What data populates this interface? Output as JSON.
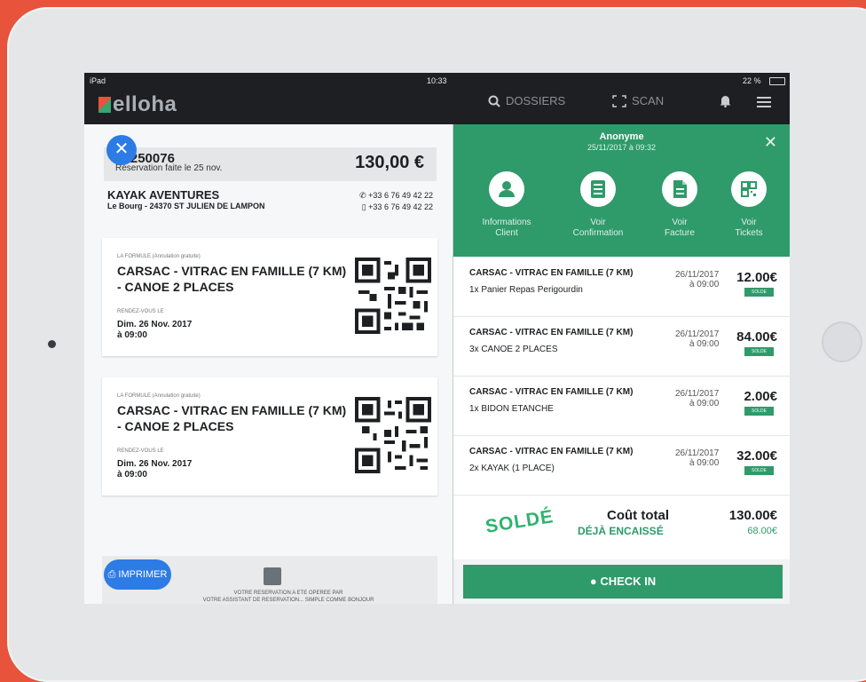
{
  "status": {
    "device": "iPad",
    "time": "10:33",
    "battery": "22 %"
  },
  "app": {
    "logo": "elloha",
    "nav_dossiers": "DOSSIERS",
    "nav_scan": "SCAN"
  },
  "reservation": {
    "number": "11250076",
    "made_on": "Réservation faite le 25 nov.",
    "price": "130,00 €",
    "company": "KAYAK AVENTURES",
    "address": "Le Bourg - 24370 ST JULIEN DE LAMPON",
    "phone1": "+33 6 76 49 42 22",
    "phone2": "+33 6 76 49 42 22"
  },
  "tickets": [
    {
      "formula": "LA FORMULE (Annulation gratuite)",
      "activity": "CARSAC - VITRAC EN FAMILLE (7 KM) - CANOE 2 PLACES",
      "rdv_label": "RENDEZ-VOUS LE",
      "date": "Dim. 26 Nov. 2017",
      "time": "à 09:00"
    },
    {
      "formula": "LA FORMULE (Annulation gratuite)",
      "activity": "CARSAC - VITRAC EN FAMILLE (7 KM) - CANOE 2 PLACES",
      "rdv_label": "RENDEZ-VOUS LE",
      "date": "Dim. 26 Nov. 2017",
      "time": "à 09:00"
    }
  ],
  "print_label": "IMPRIMER",
  "footer": {
    "line1": "VOTRE RESERVATION A ETE OPEREE PAR",
    "line2": "VOTRE ASSISTANT DE RESERVATION... SIMPLE COMME BONJOUR"
  },
  "client": {
    "name": "Anonyme",
    "date": "25/11/2017 à 09:32"
  },
  "actions": [
    {
      "line1": "Informations",
      "line2": "Client",
      "icon": "user-icon"
    },
    {
      "line1": "Voir",
      "line2": "Confirmation",
      "icon": "list-icon"
    },
    {
      "line1": "Voir",
      "line2": "Facture",
      "icon": "document-icon"
    },
    {
      "line1": "Voir",
      "line2": "Tickets",
      "icon": "qr-icon"
    }
  ],
  "orders": [
    {
      "title": "CARSAC - VITRAC EN FAMILLE (7 KM)",
      "item": "1x Panier Repas Perigourdin",
      "date": "26/11/2017",
      "time": "à 09:00",
      "amount": "12.00€",
      "badge": "SOLDE"
    },
    {
      "title": "CARSAC - VITRAC EN FAMILLE (7 KM)",
      "item": "3x CANOE 2 PLACES",
      "date": "26/11/2017",
      "time": "à 09:00",
      "amount": "84.00€",
      "badge": "SOLDE"
    },
    {
      "title": "CARSAC - VITRAC EN FAMILLE (7 KM)",
      "item": "1x BIDON ETANCHE",
      "date": "26/11/2017",
      "time": "à 09:00",
      "amount": "2.00€",
      "badge": "SOLDE"
    },
    {
      "title": "CARSAC - VITRAC EN FAMILLE (7 KM)",
      "item": "2x KAYAK (1 PLACE)",
      "date": "26/11/2017",
      "time": "à 09:00",
      "amount": "32.00€",
      "badge": "SOLDE"
    }
  ],
  "summary": {
    "stamp": "SOLDÉ",
    "total_label": "Coût total",
    "paid_label": "DÉJÀ ENCAISSÉ",
    "total": "130.00€",
    "paid": "68.00€"
  },
  "checkin_label": "CHECK IN",
  "colors": {
    "green": "#2f9a6a",
    "blue": "#2d7be5",
    "background": "#e8533b",
    "topbar": "#1d1f22"
  }
}
